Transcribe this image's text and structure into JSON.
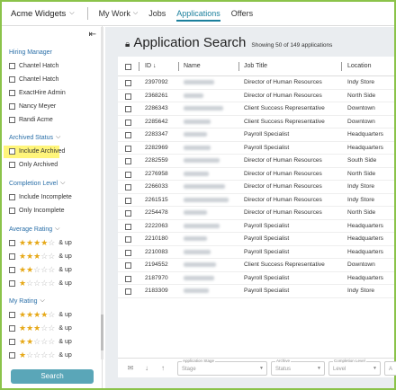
{
  "nav": {
    "brand": "Acme Widgets",
    "items": [
      {
        "label": "My Work",
        "has_caret": true
      },
      {
        "label": "Jobs"
      },
      {
        "label": "Applications",
        "active": true
      },
      {
        "label": "Offers"
      }
    ]
  },
  "sidebar": {
    "collapse_icon": "collapse-left-icon",
    "hiring_manager": {
      "title": "Hiring Manager",
      "options": [
        "Chantel Hatch",
        "Chantel Hatch",
        "ExactHire Admin",
        "Nancy Meyer",
        "Randi Acme"
      ]
    },
    "archived_status": {
      "title": "Archived Status",
      "options": [
        "Include Archived",
        "Only Archived"
      ]
    },
    "completion_level": {
      "title": "Completion Level",
      "options": [
        "Include Incomplete",
        "Only Incomplete"
      ]
    },
    "average_rating": {
      "title": "Average Rating",
      "suffix": "& up",
      "levels": [
        4,
        3,
        2,
        1
      ]
    },
    "my_rating": {
      "title": "My Rating",
      "suffix": "& up",
      "levels": [
        4,
        3,
        2,
        1
      ]
    },
    "search_label": "Search"
  },
  "main": {
    "title": "Application Search",
    "subtitle": "Showing 50 of 149 applications",
    "columns": [
      "ID",
      "Name",
      "Job Title",
      "Location"
    ],
    "rows": [
      {
        "id": "2397092",
        "job": "Director of Human Resources",
        "location": "Indy Store"
      },
      {
        "id": "2368261",
        "job": "Director of Human Resources",
        "location": "North Side"
      },
      {
        "id": "2286343",
        "job": "Client Success Representative",
        "location": "Downtown"
      },
      {
        "id": "2285642",
        "job": "Client Success Representative",
        "location": "Downtown"
      },
      {
        "id": "2283347",
        "job": "Payroll Specialist",
        "location": "Headquarters"
      },
      {
        "id": "2282969",
        "job": "Payroll Specialist",
        "location": "Headquarters"
      },
      {
        "id": "2282559",
        "job": "Director of Human Resources",
        "location": "South Side"
      },
      {
        "id": "2276958",
        "job": "Director of Human Resources",
        "location": "North Side"
      },
      {
        "id": "2266033",
        "job": "Director of Human Resources",
        "location": "Indy Store"
      },
      {
        "id": "2261515",
        "job": "Director of Human Resources",
        "location": "Indy Store"
      },
      {
        "id": "2254478",
        "job": "Director of Human Resources",
        "location": "North Side"
      },
      {
        "id": "2222063",
        "job": "Payroll Specialist",
        "location": "Headquarters"
      },
      {
        "id": "2210180",
        "job": "Payroll Specialist",
        "location": "Headquarters"
      },
      {
        "id": "2210083",
        "job": "Payroll Specialist",
        "location": "Headquarters"
      },
      {
        "id": "2194552",
        "job": "Client Success Representative",
        "location": "Downtown"
      },
      {
        "id": "2187970",
        "job": "Payroll Specialist",
        "location": "Headquarters"
      },
      {
        "id": "2183309",
        "job": "Payroll Specialist",
        "location": "Indy Store"
      }
    ],
    "footer": {
      "icons": [
        "mail-icon",
        "arrow-down-icon",
        "arrow-up-icon"
      ],
      "filters": [
        {
          "label": "Application Stage",
          "value": "Stage"
        },
        {
          "label": "Archive",
          "value": "Status"
        },
        {
          "label": "Completion Level",
          "value": "Level"
        },
        {
          "label": "",
          "value": "A"
        }
      ]
    }
  },
  "colors": {
    "accent": "#1a7f9c",
    "search_button": "#5aa6b8",
    "highlight": "#fff57a",
    "star": "#e6a817",
    "frame": "#8bc34a"
  }
}
